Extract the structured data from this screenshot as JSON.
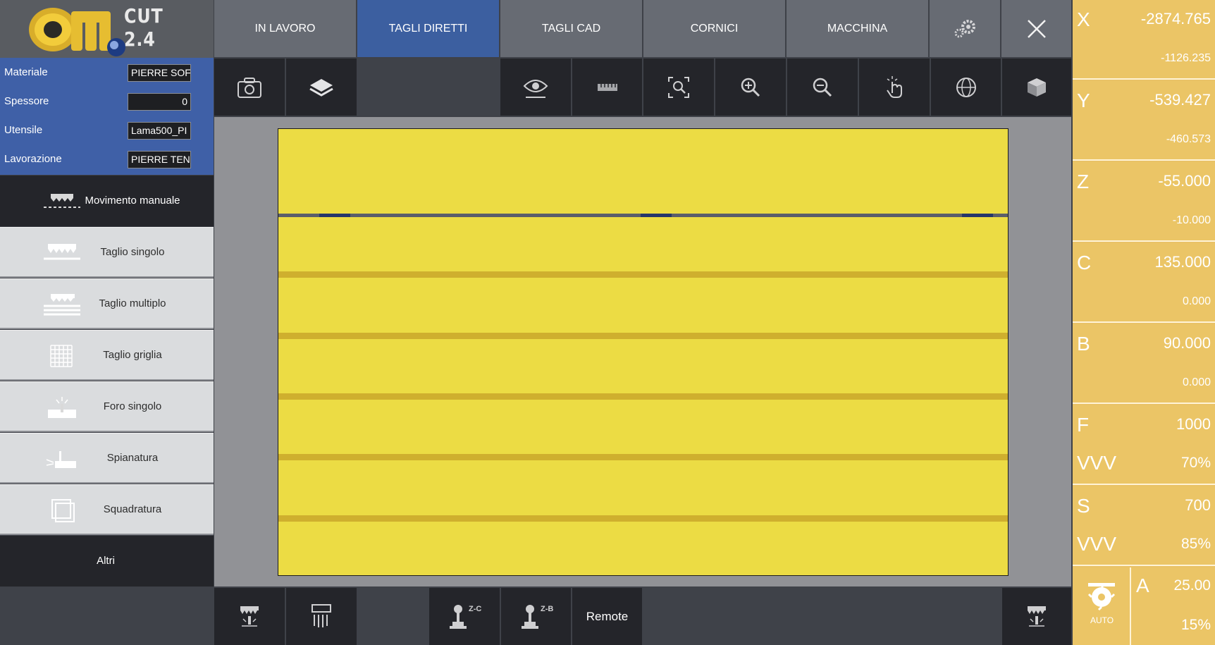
{
  "app": {
    "version_label": "CUT 2.4"
  },
  "tabs": [
    {
      "label": "IN LAVORO"
    },
    {
      "label": "TAGLI DIRETTI"
    },
    {
      "label": "TAGLI CAD"
    },
    {
      "label": "CORNICI"
    },
    {
      "label": "MACCHINA"
    }
  ],
  "active_tab": "TAGLI DIRETTI",
  "params": {
    "materiale": {
      "label": "Materiale",
      "value": "PIERRE SOFT"
    },
    "spessore": {
      "label": "Spessore",
      "value": "0"
    },
    "utensile": {
      "label": "Utensile",
      "value": "Lama500_PI"
    },
    "lavorazione": {
      "label": "Lavorazione",
      "value": "PIERRE TENDRE"
    }
  },
  "menu": {
    "movimento_manuale": "Movimento manuale",
    "taglio_singolo": "Taglio singolo",
    "taglio_multiplo": "Taglio multiplo",
    "taglio_griglia": "Taglio griglia",
    "foro_singolo": "Foro singolo",
    "spianatura": "Spianatura",
    "squadratura": "Squadratura",
    "altri": "Altri"
  },
  "toolbar_icons": [
    "camera-icon",
    "layers-icon",
    "eye-icon",
    "ruler-icon",
    "zoom-fit-icon",
    "zoom-in-icon",
    "zoom-out-icon",
    "touch-icon",
    "globe-icon",
    "cube-icon"
  ],
  "bottom": {
    "z_c_label": "Z-C",
    "z_b_label": "Z-B",
    "remote_label": "Remote"
  },
  "axes": {
    "x": {
      "name": "X",
      "value": "-2874.765",
      "sub": "-1126.235"
    },
    "y": {
      "name": "Y",
      "value": "-539.427",
      "sub": "-460.573"
    },
    "z": {
      "name": "Z",
      "value": "-55.000",
      "sub": "-10.000"
    },
    "c": {
      "name": "C",
      "value": "135.000",
      "sub": "0.000"
    },
    "b": {
      "name": "B",
      "value": "90.000",
      "sub": "0.000"
    },
    "f": {
      "name": "F",
      "value": "1000",
      "vvv_label": "VVV",
      "vvv_value": "70%"
    },
    "s": {
      "name": "S",
      "value": "700",
      "vvv_label": "VVV",
      "vvv_value": "85%"
    },
    "a": {
      "name": "A",
      "value": "25.00",
      "percent": "15%"
    },
    "auto_label": "AUTO"
  },
  "colors": {
    "active_tab": "#3c5fa0",
    "sheet": "#ecdc44",
    "axis_panel": "#ebc566"
  }
}
